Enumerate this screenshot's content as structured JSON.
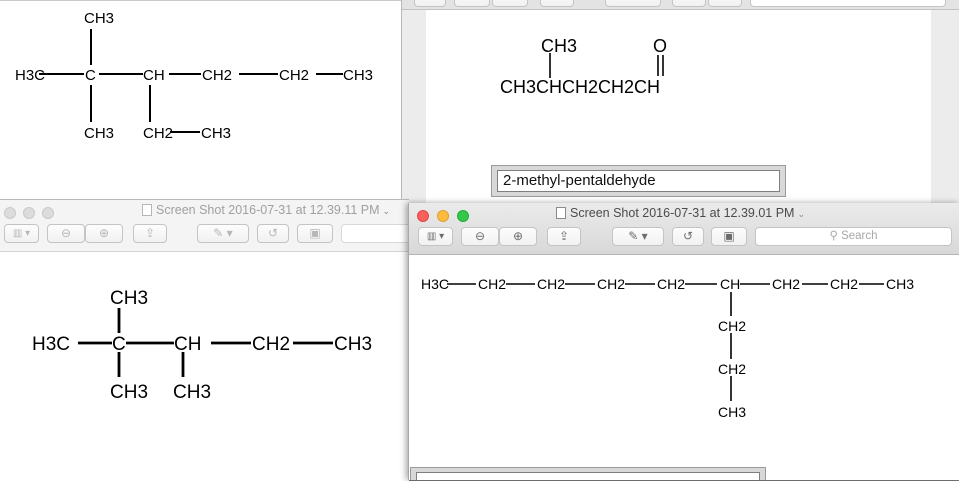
{
  "window_top_left": {
    "formula": {
      "top_methyl": "CH3",
      "left_methyl": "H3C",
      "quaternary_carbon": "C",
      "ch_carbon": "CH",
      "chain_ch2_a": "CH2",
      "chain_ch2_b": "CH2",
      "chain_end": "CH3",
      "bottom_methyl": "CH3",
      "branch_ch2": "CH2",
      "branch_end": "CH3"
    }
  },
  "window_top_right": {
    "formula": {
      "branch_methyl": "CH3",
      "carbonyl_oxygen": "O",
      "main_chain": "CH3CHCH2CH2CH"
    },
    "name_box_value": "2-methyl-pentaldehyde"
  },
  "window_bottom_left": {
    "title": "Screen Shot 2016-07-31 at 12.39.11 PM",
    "formula": {
      "top_methyl": "CH3",
      "left_methyl": "H3C",
      "quaternary_carbon": "C",
      "ch_carbon": "CH",
      "chain_ch2": "CH2",
      "chain_end": "CH3",
      "bottom_methyl": "CH3",
      "branch_methyl": "CH3"
    }
  },
  "window_bottom_right": {
    "title": "Screen Shot 2016-07-31 at 12.39.01 PM",
    "search_placeholder": "Search",
    "formula": {
      "chain": [
        "H3C",
        "CH2",
        "CH2",
        "CH2",
        "CH2",
        "CH",
        "CH2",
        "CH2",
        "CH3"
      ],
      "branch": [
        "CH2",
        "CH2",
        "CH3"
      ]
    }
  }
}
